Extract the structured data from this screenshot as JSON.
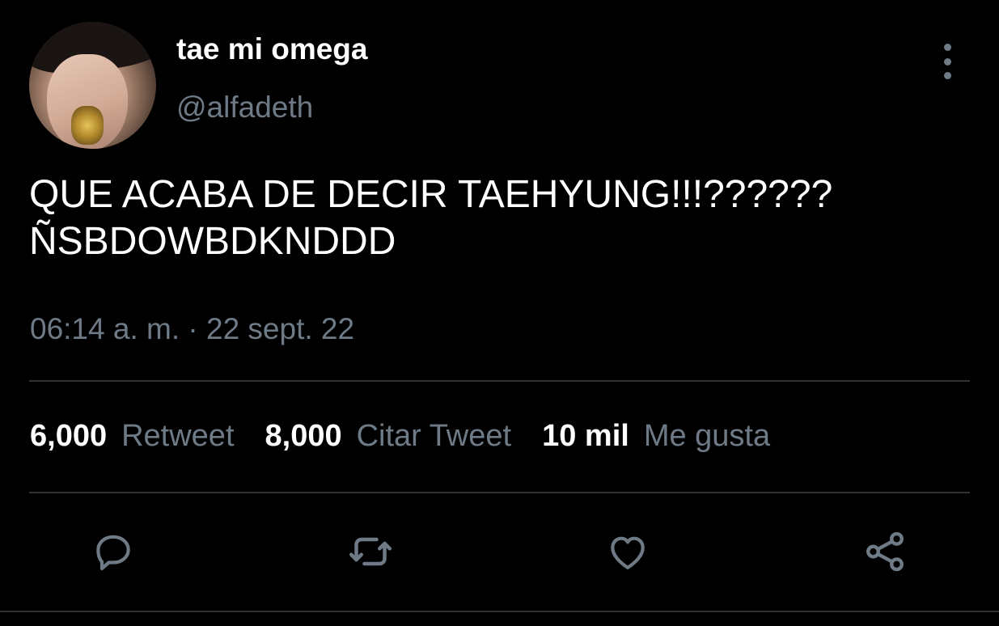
{
  "user": {
    "display_name": "tae mi omega",
    "handle": "@alfadeth",
    "avatar_icon": "profile-photo"
  },
  "tweet": {
    "lines": [
      "QUE ACABA DE DECIR TAEHYUNG!!!??????",
      "ÑSBDOWBDKNDDD"
    ],
    "timestamp": "06:14 a. m. · 22 sept. 22"
  },
  "stats": {
    "retweets_count": "6,000",
    "retweets_label": "Retweet",
    "quotes_count": "8,000",
    "quotes_label": "Citar Tweet",
    "likes_count": "10 mil",
    "likes_label": "Me gusta"
  },
  "actions": {
    "reply_icon": "reply-icon",
    "retweet_icon": "retweet-icon",
    "like_icon": "heart-icon",
    "share_icon": "share-icon"
  },
  "colors": {
    "background": "#000000",
    "text_primary": "#ffffff",
    "text_secondary": "#6e7b87",
    "divider": "#2f3336"
  }
}
